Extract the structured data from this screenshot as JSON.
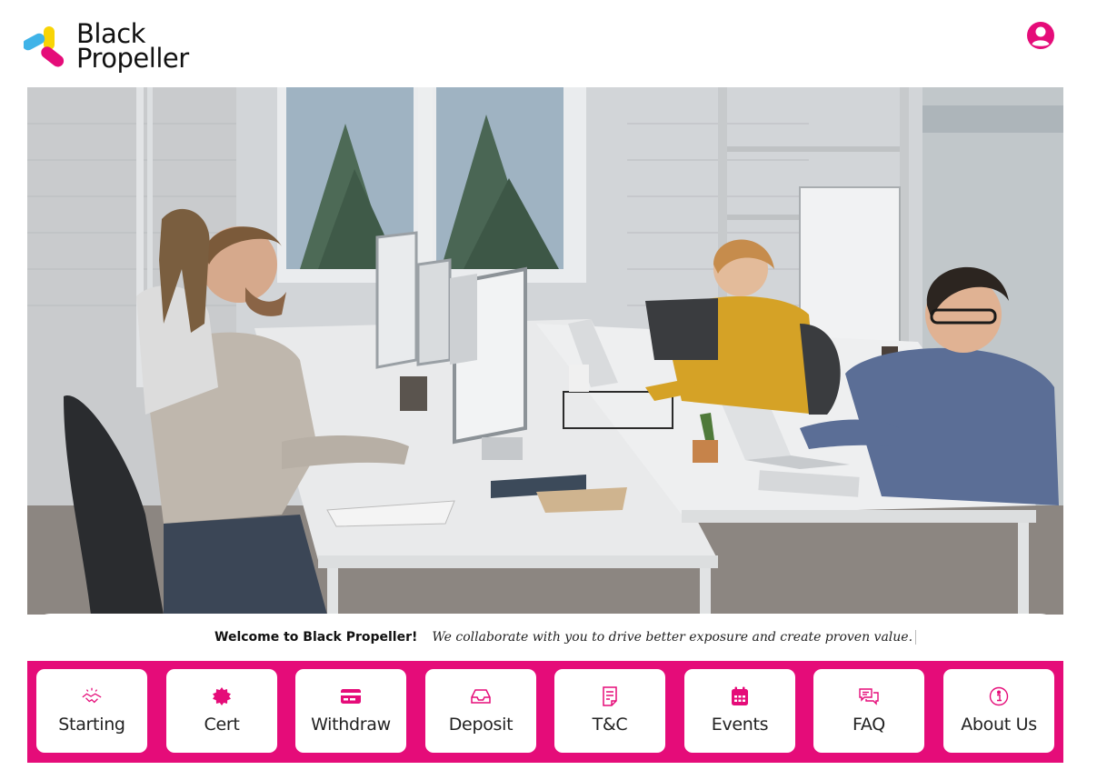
{
  "brand": {
    "name_line1": "Black",
    "name_line2": "Propeller",
    "accent_color": "#e50c79"
  },
  "header": {
    "profile_icon": "user-circle-icon"
  },
  "hero": {
    "image_description_icon": "office-photo"
  },
  "ticker": {
    "headline": "Welcome to Black Propeller!",
    "tagline": "We collaborate with you to drive better exposure and create proven value."
  },
  "nav": {
    "items": [
      {
        "label": "Starting",
        "icon": "handshake-icon"
      },
      {
        "label": "Cert",
        "icon": "badge-icon"
      },
      {
        "label": "Withdraw",
        "icon": "card-icon"
      },
      {
        "label": "Deposit",
        "icon": "inbox-icon"
      },
      {
        "label": "T&C",
        "icon": "document-icon"
      },
      {
        "label": "Events",
        "icon": "calendar-icon"
      },
      {
        "label": "FAQ",
        "icon": "chat-icon"
      },
      {
        "label": "About Us",
        "icon": "info-icon"
      }
    ]
  }
}
